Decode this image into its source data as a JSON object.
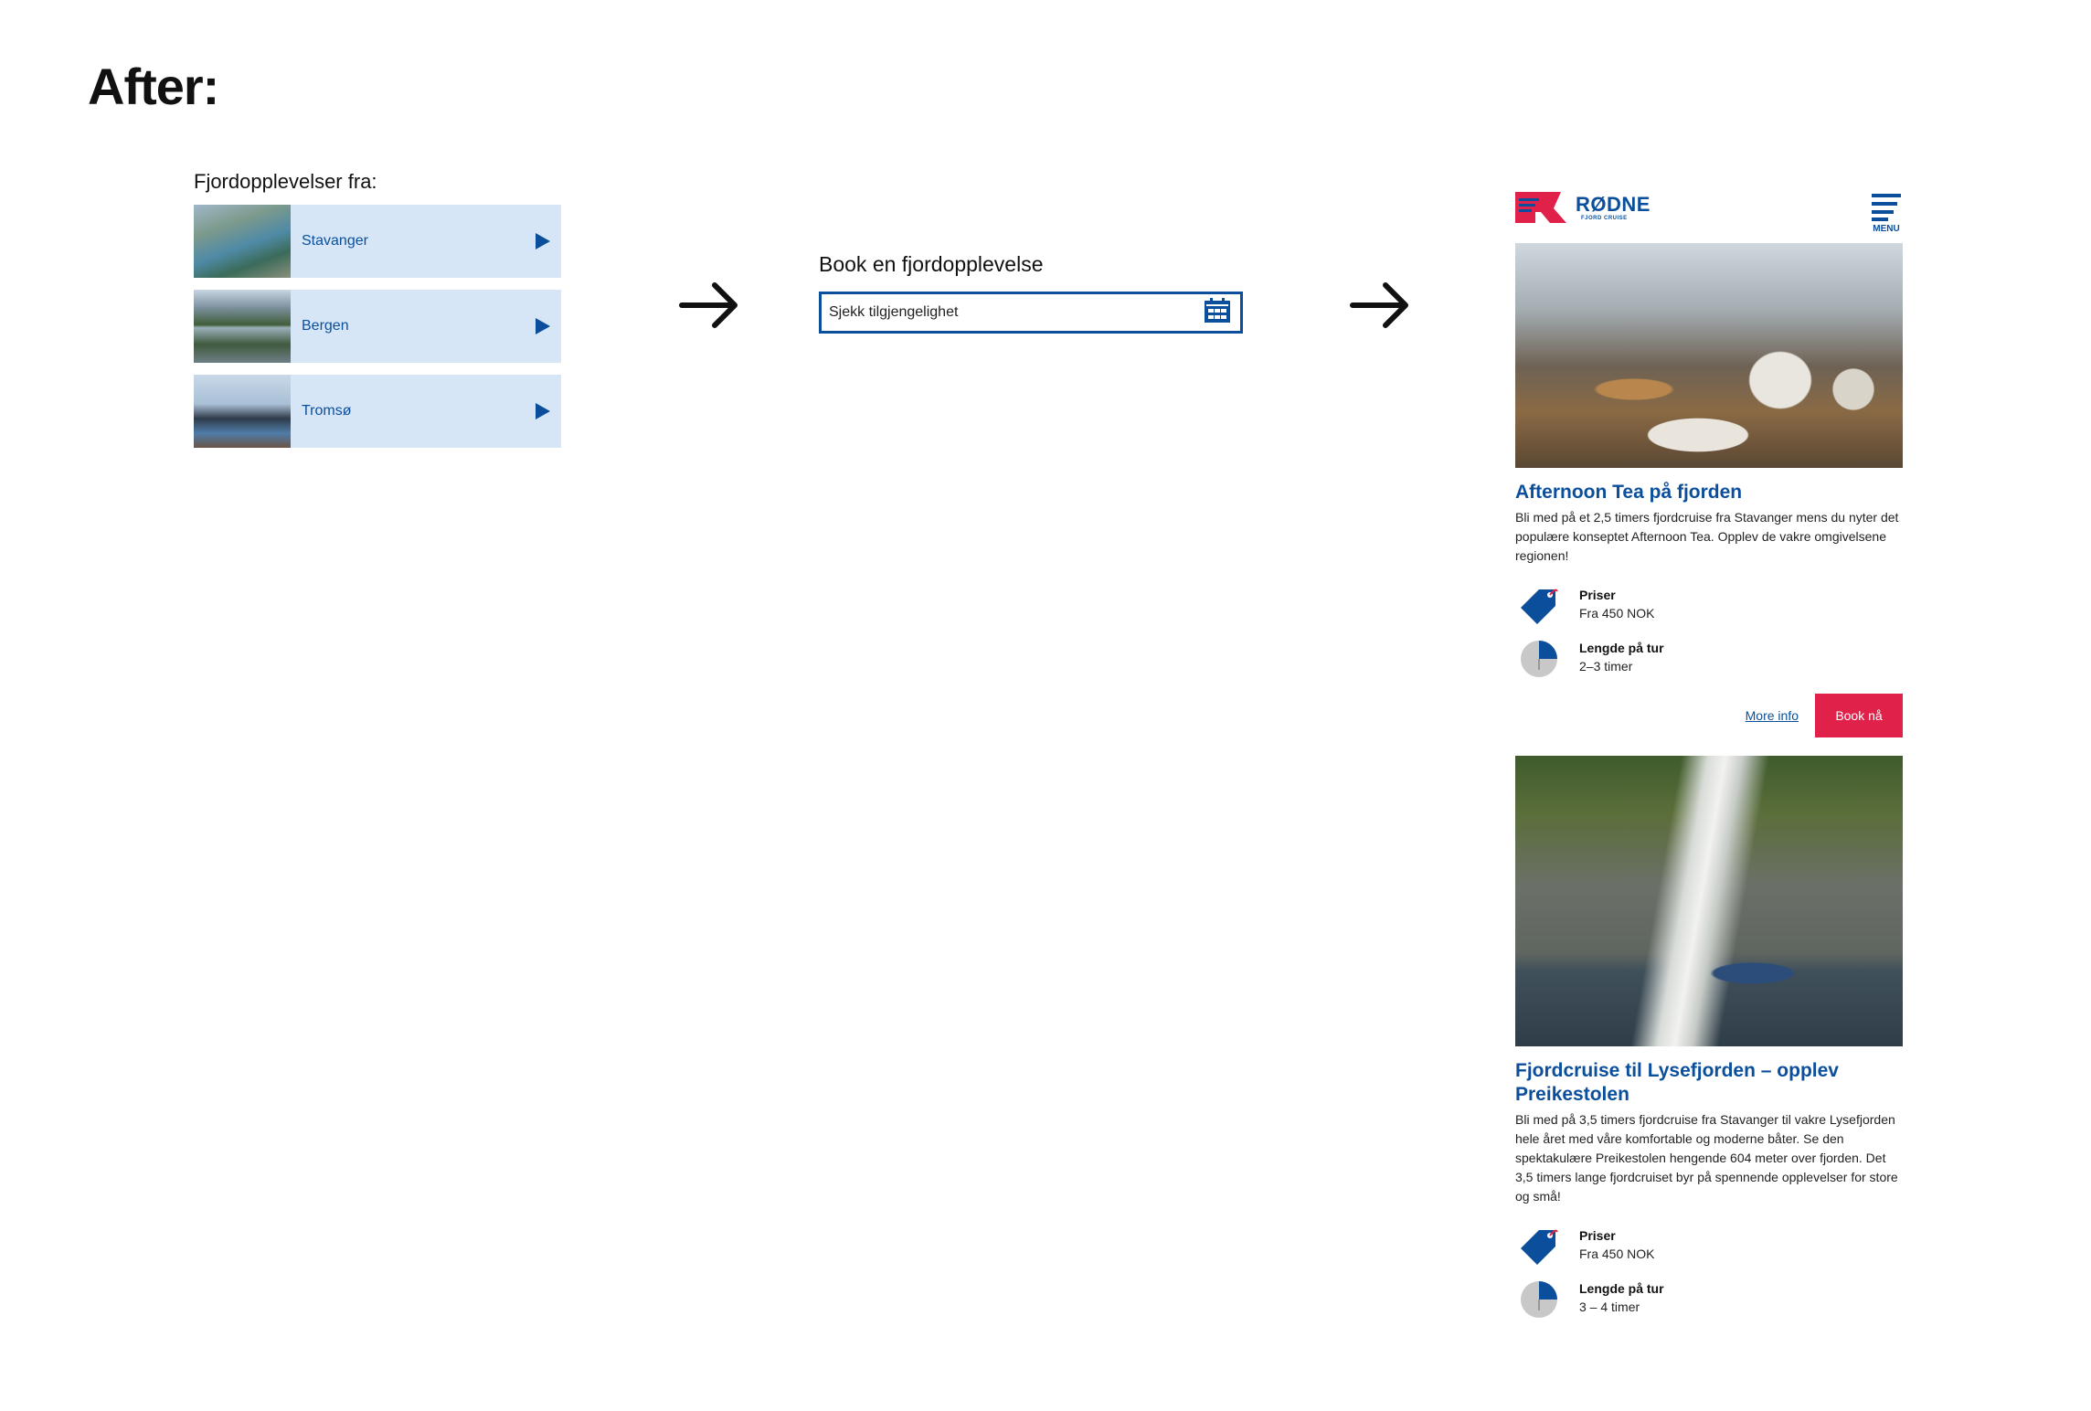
{
  "heading": "After:",
  "step1": {
    "title": "Fjordopplevelser fra:",
    "cities": [
      {
        "label": "Stavanger"
      },
      {
        "label": "Bergen"
      },
      {
        "label": "Tromsø"
      }
    ]
  },
  "step2": {
    "title": "Book en fjordopplevelse",
    "input_placeholder": "Sjekk tilgjengelighet"
  },
  "mobile": {
    "logo_name": "RØDNE",
    "logo_sub": "FJORD CRUISE",
    "menu_label": "MENU",
    "cards": [
      {
        "title": "Afternoon Tea på fjorden",
        "description": "Bli med på et 2,5 timers fjordcruise fra Stavanger mens du nyter det populære konseptet Afternoon Tea. Opplev de vakre omgivelsene regionen!",
        "price_label": "Priser",
        "price_value": "Fra 450 NOK",
        "duration_label": "Lengde på tur",
        "duration_value": "2–3 timer",
        "more_link": "More info",
        "book_button": "Book nå"
      },
      {
        "title": "Fjordcruise til Lysefjorden – opplev Preikestolen",
        "description": "Bli med på 3,5 timers fjordcruise fra Stavanger til vakre Lysefjorden hele året med våre komfortable og moderne båter. Se den spektakulære Preikestolen hengende 604 meter over fjorden. Det 3,5 timers lange fjordcruiset byr på spennende opplevelser for store og små!",
        "price_label": "Priser",
        "price_value": "Fra 450 NOK",
        "duration_label": "Lengde på tur",
        "duration_value": "3 – 4 timer"
      }
    ]
  },
  "colors": {
    "brand_blue": "#0b4f9c",
    "brand_red": "#e0224b",
    "light_blue": "#d6e6f7"
  }
}
